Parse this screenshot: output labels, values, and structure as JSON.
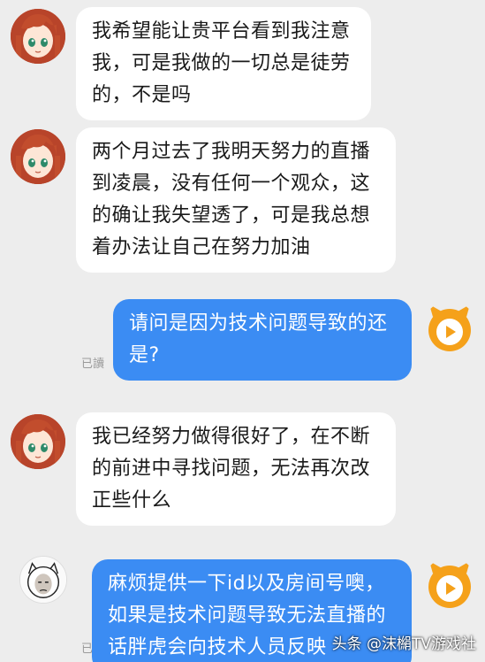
{
  "messages": [
    {
      "side": "in",
      "avatar": "anime-girl-avatar",
      "text": "我希望能让贵平台看到我注意\n我，可是我做的一切总是徒劳\n的，不是吗"
    },
    {
      "side": "in",
      "avatar": "anime-girl-avatar",
      "text": "两个月过去了我明天努力的直播\n到凌晨，没有任何一个观众，这\n的确让我失望透了，可是我总想\n着办法让自己在努力加油"
    },
    {
      "side": "out",
      "avatar": "orange-mascot-avatar",
      "text": "请问是因为技术问题导致的还\n是?",
      "read": "已讀"
    },
    {
      "side": "in",
      "avatar": "anime-girl-avatar",
      "text": "我已经努力做得很好了，在不断\n的前进中寻找问题，无法再次改\n正些什么"
    },
    {
      "side": "out",
      "avatar": "orange-mascot-avatar",
      "text": "麻烦提供一下id以及房间号噢，\n如果是技术问题导致无法直播的\n话胖虎会向技术人员反映",
      "read": "已讀"
    }
  ],
  "meme_avatar": "meme-face-avatar",
  "watermark": "头条 @沫㯞TV游戏社",
  "colors": {
    "background": "#ededed",
    "incoming_bubble": "#ffffff",
    "outgoing_bubble": "#3b8cf3"
  }
}
